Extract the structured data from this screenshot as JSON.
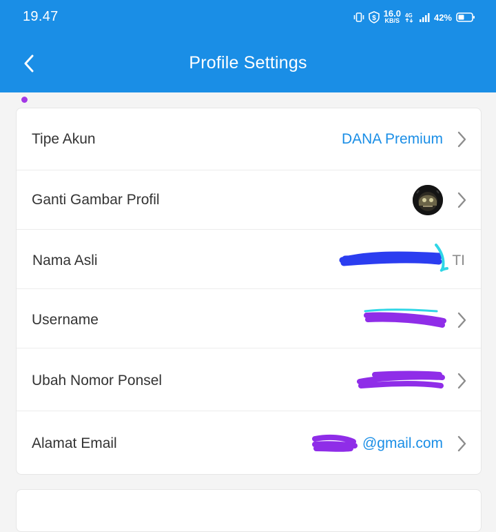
{
  "status_bar": {
    "time": "19.47",
    "net_speed_value": "16.0",
    "net_speed_unit": "KB/S",
    "battery_percent": "42%",
    "icons": [
      "vibrate-icon",
      "shield-dollar-icon",
      "network-4g-icon",
      "signal-icon",
      "battery-icon"
    ]
  },
  "header": {
    "title": "Profile Settings",
    "back_icon": "chevron-left-icon"
  },
  "settings": {
    "tipe_akun": {
      "label": "Tipe Akun",
      "value": "DANA Premium"
    },
    "ganti_gambar": {
      "label": "Ganti Gambar Profil"
    },
    "nama_asli": {
      "label": "Nama Asli",
      "value": "TI"
    },
    "username": {
      "label": "Username",
      "value": ""
    },
    "nomor_ponsel": {
      "label": "Ubah Nomor Ponsel",
      "value": ""
    },
    "email": {
      "label": "Alamat Email",
      "value": "@gmail.com"
    }
  },
  "colors": {
    "primary": "#1a8ee6",
    "value_text": "#1a8ee6",
    "scribble_blue": "#2b3df0",
    "scribble_purple": "#8f2de8",
    "scribble_cyan": "#2fd6e6"
  }
}
